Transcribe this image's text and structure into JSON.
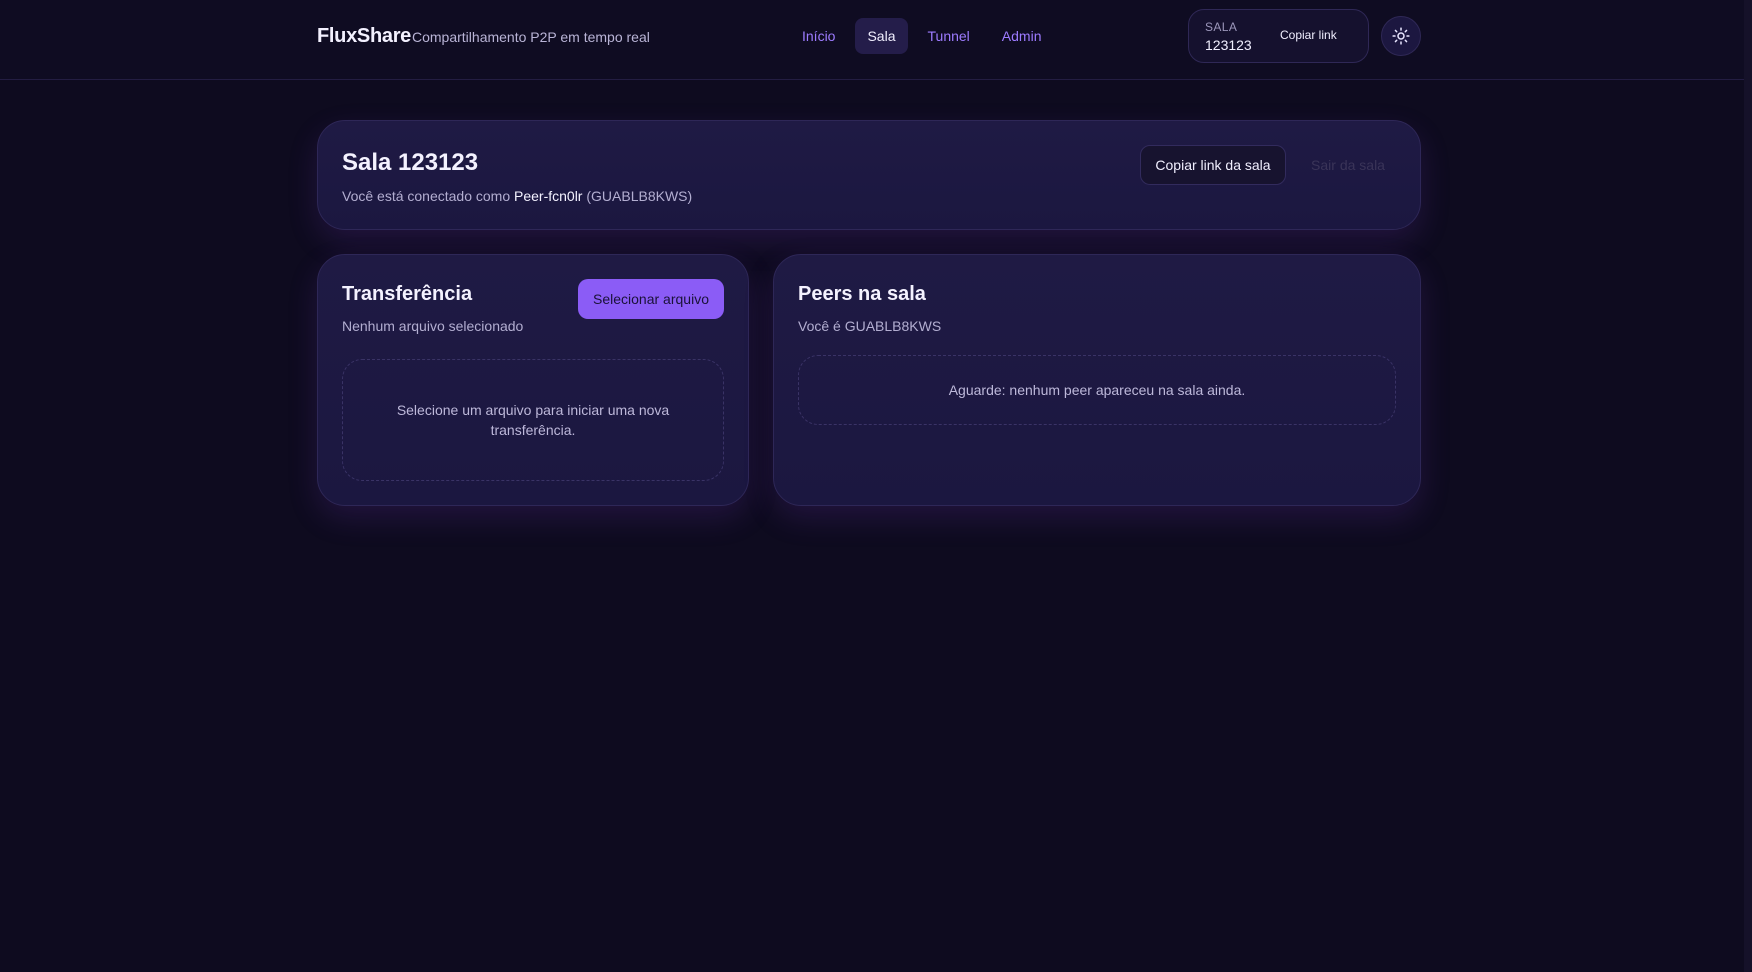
{
  "header": {
    "brand": "FluxShare",
    "tagline": "Compartilhamento P2P em tempo real",
    "nav": [
      {
        "label": "Início",
        "active": false
      },
      {
        "label": "Sala",
        "active": true
      },
      {
        "label": "Tunnel",
        "active": false
      },
      {
        "label": "Admin",
        "active": false
      }
    ],
    "room_chip": {
      "label": "SALA",
      "value": "123123",
      "copy_label": "Copiar link"
    },
    "theme_icon": "sun-icon"
  },
  "room": {
    "title": "Sala 123123",
    "connected_prefix": "Você está conectado como",
    "peer_name": "Peer-fcn0lr",
    "peer_id": "(GUABLB8KWS)",
    "copy_button": "Copiar link da sala",
    "leave_button": "Sair da sala"
  },
  "transfer": {
    "title": "Transferência",
    "status": "Nenhum arquivo selecionado",
    "select_button": "Selecionar arquivo",
    "empty_text": "Selecione um arquivo para iniciar uma nova transferência."
  },
  "peers": {
    "title": "Peers na sala",
    "self_text": "Você é GUABLB8KWS",
    "empty_text": "Aguarde: nenhum peer apareceu na sala ainda."
  },
  "colors": {
    "background": "#0e0b1f",
    "accent": "#8b5cf6",
    "nav_link": "#9d7bff",
    "card": "#1f1a44"
  }
}
